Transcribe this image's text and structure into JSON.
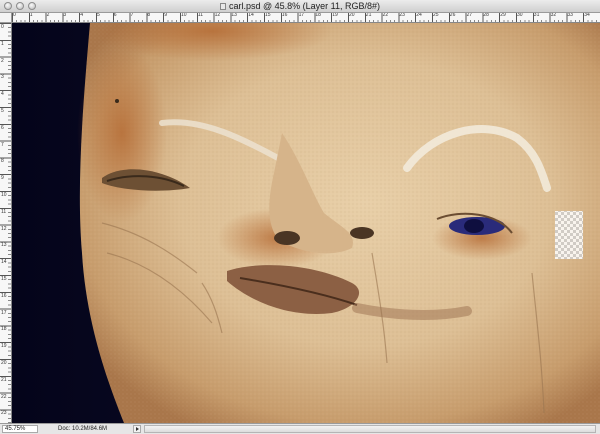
{
  "window": {
    "title": "carl.psd @ 45.8% (Layer 11, RGB/8#)"
  },
  "rulers": {
    "horizontal_labels": [
      "0",
      "1",
      "2",
      "3",
      "4",
      "5",
      "6",
      "7",
      "8",
      "9",
      "10",
      "11",
      "12",
      "13",
      "14",
      "15",
      "16",
      "17",
      "18",
      "19",
      "20",
      "21",
      "22",
      "23",
      "24",
      "25",
      "26",
      "27",
      "28",
      "29",
      "30",
      "31",
      "32",
      "33",
      "34"
    ],
    "vertical_labels": [
      "0",
      "1",
      "2",
      "3",
      "4",
      "5",
      "6",
      "7",
      "8",
      "9",
      "10",
      "11",
      "12",
      "13",
      "14",
      "15",
      "16",
      "17",
      "18",
      "19",
      "20",
      "21",
      "22",
      "23"
    ]
  },
  "status": {
    "zoom": "45.75%",
    "doc_info": "Doc: 10.2M/84.6M"
  },
  "icons": [
    "close-button-icon",
    "minimize-button-icon",
    "zoom-button-icon",
    "document-icon",
    "status-menu-arrow-icon"
  ]
}
